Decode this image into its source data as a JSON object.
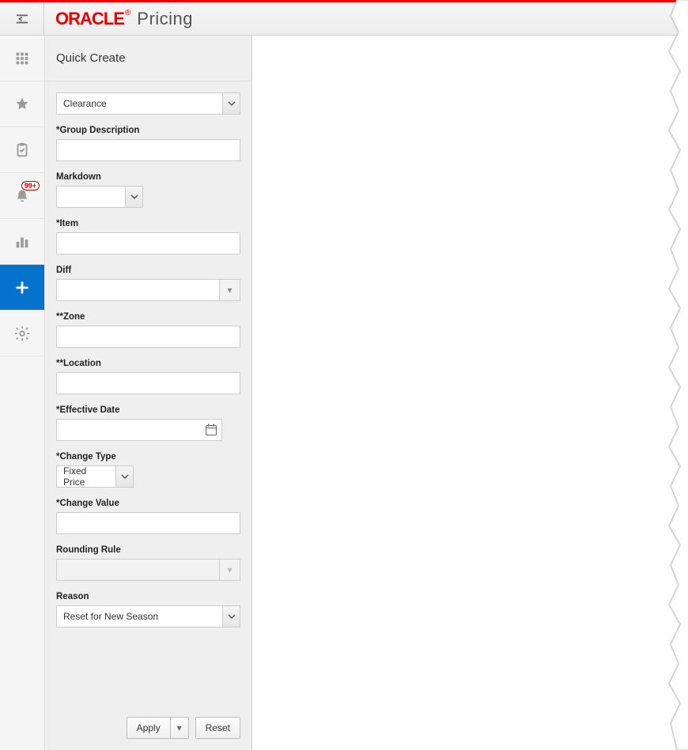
{
  "header": {
    "brand": "ORACLE",
    "product": "Pricing"
  },
  "nav": {
    "menu_icon": "menu-icon",
    "items": [
      {
        "name": "apps",
        "icon": "grid-icon"
      },
      {
        "name": "favorites",
        "icon": "star-icon"
      },
      {
        "name": "tasks",
        "icon": "clipboard-icon"
      },
      {
        "name": "notifications",
        "icon": "bell-icon",
        "badge": "99+"
      },
      {
        "name": "reports",
        "icon": "bars-icon"
      },
      {
        "name": "quick-create",
        "icon": "plus-icon",
        "active": true
      },
      {
        "name": "settings",
        "icon": "gear-icon"
      }
    ]
  },
  "panel": {
    "title": "Quick Create",
    "type_select": {
      "value": "Clearance"
    },
    "fields": {
      "group_description": {
        "label": "*Group Description",
        "value": ""
      },
      "markdown": {
        "label": "Markdown",
        "value": ""
      },
      "item": {
        "label": "*Item",
        "value": ""
      },
      "diff": {
        "label": "Diff",
        "value": ""
      },
      "zone": {
        "label": "**Zone",
        "value": ""
      },
      "location": {
        "label": "**Location",
        "value": ""
      },
      "effective_date": {
        "label": "*Effective Date",
        "value": ""
      },
      "change_type": {
        "label": "*Change Type",
        "value": "Fixed Price"
      },
      "change_value": {
        "label": "*Change Value",
        "value": ""
      },
      "rounding_rule": {
        "label": "Rounding Rule",
        "value": ""
      },
      "reason": {
        "label": "Reason",
        "value": "Reset for New Season"
      }
    },
    "buttons": {
      "apply": "Apply",
      "reset": "Reset"
    }
  }
}
